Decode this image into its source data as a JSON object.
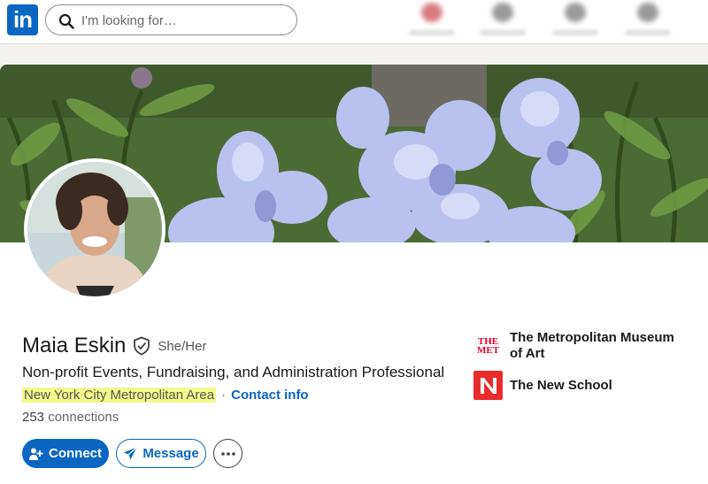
{
  "nav": {
    "logo_text": "in",
    "search_placeholder": "I'm looking for…",
    "icons": [
      "search-icon",
      "notification-icon",
      "nav-icon",
      "nav-icon",
      "nav-icon"
    ]
  },
  "profile": {
    "name": "Maia Eskin",
    "pronouns": "She/Her",
    "headline": "Non-profit Events, Fundraising, and Administration Professional",
    "location": "New York City Metropolitan Area",
    "separator": "·",
    "contact_info_label": "Contact info",
    "connections_count": "253",
    "connections_label": "connections",
    "verified_icon": "shield-check-icon"
  },
  "actions": {
    "connect_label": "Connect",
    "message_label": "Message",
    "more_label": "···"
  },
  "organizations": [
    {
      "name": "The Metropolitan Museum of Art",
      "logo_text": "THE MET"
    },
    {
      "name": "The New School",
      "logo_text": "N"
    }
  ],
  "colors": {
    "brand": "#0a66c2",
    "highlight": "#f3f98a",
    "met_red": "#e4002b",
    "new_school_red": "#e82c2c"
  }
}
